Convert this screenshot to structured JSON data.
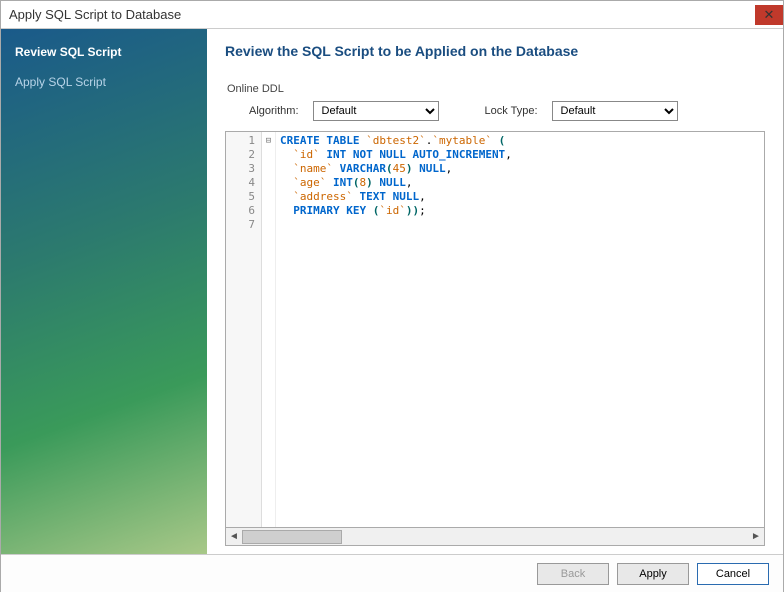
{
  "window": {
    "title": "Apply SQL Script to Database"
  },
  "sidebar": {
    "steps": [
      {
        "label": "Review SQL Script",
        "active": true
      },
      {
        "label": "Apply SQL Script",
        "active": false
      }
    ]
  },
  "main": {
    "title": "Review the SQL Script to be Applied on the Database",
    "ddl": {
      "legend": "Online DDL",
      "algorithm_label": "Algorithm:",
      "algorithm_value": "Default",
      "locktype_label": "Lock Type:",
      "locktype_value": "Default"
    },
    "editor": {
      "line_numbers": [
        "1",
        "2",
        "3",
        "4",
        "5",
        "6",
        "7"
      ],
      "fold_marker": "⊟",
      "code_lines": [
        {
          "tokens": [
            {
              "t": "CREATE TABLE",
              "c": "kw"
            },
            {
              "t": " "
            },
            {
              "t": "`dbtest2`",
              "c": "id"
            },
            {
              "t": "."
            },
            {
              "t": "`mytable`",
              "c": "id"
            },
            {
              "t": " "
            },
            {
              "t": "(",
              "c": "pn"
            }
          ]
        },
        {
          "indent": "  ",
          "tokens": [
            {
              "t": "`id`",
              "c": "id"
            },
            {
              "t": " "
            },
            {
              "t": "INT NOT NULL AUTO_INCREMENT",
              "c": "kw"
            },
            {
              "t": ","
            }
          ]
        },
        {
          "indent": "  ",
          "tokens": [
            {
              "t": "`name`",
              "c": "id"
            },
            {
              "t": " "
            },
            {
              "t": "VARCHAR",
              "c": "kw"
            },
            {
              "t": "(",
              "c": "pn"
            },
            {
              "t": "45",
              "c": "num"
            },
            {
              "t": ")",
              "c": "pn"
            },
            {
              "t": " "
            },
            {
              "t": "NULL",
              "c": "kw"
            },
            {
              "t": ","
            }
          ]
        },
        {
          "indent": "  ",
          "tokens": [
            {
              "t": "`age`",
              "c": "id"
            },
            {
              "t": " "
            },
            {
              "t": "INT",
              "c": "kw"
            },
            {
              "t": "(",
              "c": "pn"
            },
            {
              "t": "8",
              "c": "num"
            },
            {
              "t": ")",
              "c": "pn"
            },
            {
              "t": " "
            },
            {
              "t": "NULL",
              "c": "kw"
            },
            {
              "t": ","
            }
          ]
        },
        {
          "indent": "  ",
          "tokens": [
            {
              "t": "`address`",
              "c": "id"
            },
            {
              "t": " "
            },
            {
              "t": "TEXT NULL",
              "c": "kw"
            },
            {
              "t": ","
            }
          ]
        },
        {
          "indent": "  ",
          "tokens": [
            {
              "t": "PRIMARY KEY",
              "c": "kw"
            },
            {
              "t": " "
            },
            {
              "t": "(",
              "c": "pn"
            },
            {
              "t": "`id`",
              "c": "id"
            },
            {
              "t": ")",
              "c": "pn"
            },
            {
              "t": ")",
              "c": "pn"
            },
            {
              "t": ";"
            }
          ]
        },
        {
          "tokens": []
        }
      ]
    }
  },
  "footer": {
    "back": "Back",
    "apply": "Apply",
    "cancel": "Cancel"
  }
}
